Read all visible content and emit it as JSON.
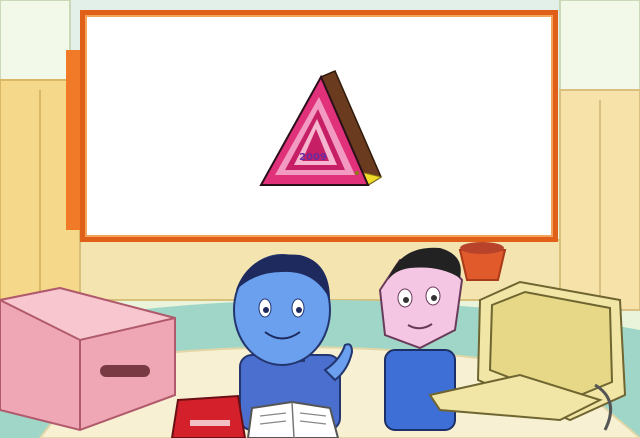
{
  "scene": {
    "description_icons": [
      "classroom-scene",
      "cheese-triangle-block",
      "pink-box",
      "red-book",
      "open-notebook",
      "computer-monitor",
      "blue-character",
      "pink-hexagon-character"
    ]
  },
  "display_panel": {
    "block_label": "2009"
  },
  "colors": {
    "panel_border": "#e0601a",
    "triangle_outer": "#e0317a",
    "triangle_inner": "#c71f66",
    "desk": "#f5efcf",
    "wall": "#eaf4da",
    "floor_green": "#9fd6c8",
    "box_pink": "#f0a7b5"
  }
}
